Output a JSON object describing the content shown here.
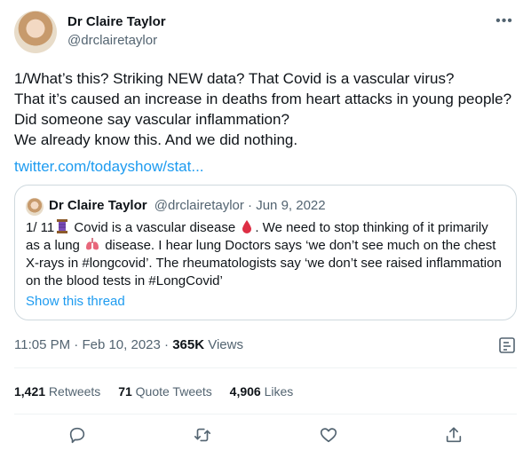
{
  "author": {
    "name": "Dr Claire Taylor",
    "handle": "@drclairetaylor",
    "avatar_icon": "profile-photo"
  },
  "tweet": {
    "lines": [
      "1/What’s this? Striking NEW data? That Covid is a vascular virus?",
      "That it’s caused an increase in deaths from heart attacks in young people?",
      "Did someone say vascular inflammation?",
      "We already know this. And we did nothing."
    ],
    "link": "twitter.com/todayshow/stat..."
  },
  "quote": {
    "name": "Dr Claire Taylor",
    "handle": "@drclairetaylor",
    "separator": " · ",
    "date": "Jun 9, 2022",
    "line1_a": "1/ 11",
    "line1_b": " Covid is a vascular disease ",
    "line1_c": ". We need to stop thinking of it primarily",
    "line2_a": "as a lung ",
    "line2_b": " disease. I hear lung Doctors says ‘we don’t see much on the chest",
    "line3": "X-rays in #longcovid’. The rheumatologists say ‘we don’t see raised inflammation",
    "line4": "on the blood tests in #LongCovid’",
    "show_thread": "Show this thread",
    "emojis": [
      "thread-spool-icon",
      "blood-drop-icon",
      "lungs-icon"
    ]
  },
  "meta": {
    "time": "11:05 PM",
    "separator": " · ",
    "date": "Feb 10, 2023",
    "views_count": "365K",
    "views_label": " Views"
  },
  "stats": {
    "retweets_count": "1,421",
    "retweets_label": " Retweets",
    "quotes_count": "71",
    "quotes_label": " Quote Tweets",
    "likes_count": "4,906",
    "likes_label": " Likes"
  },
  "colors": {
    "text": "#0f1419",
    "secondary": "#536471",
    "link": "#1d9bf0",
    "border": "#cfd9de"
  }
}
